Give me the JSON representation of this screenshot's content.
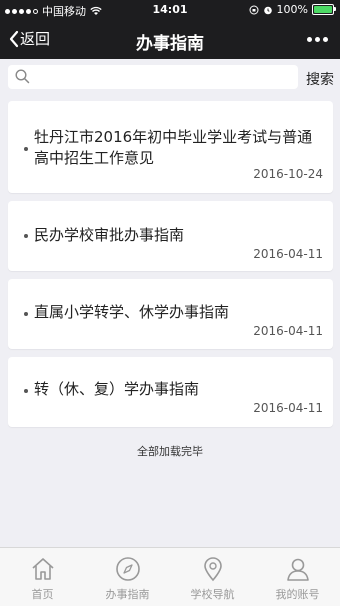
{
  "status_bar": {
    "carrier": "中国移动",
    "time": "14:01",
    "battery": "100%"
  },
  "nav": {
    "back_label": "返回",
    "title": "办事指南"
  },
  "search": {
    "placeholder": "",
    "button_label": "搜索"
  },
  "articles": [
    {
      "title": "牡丹江市2016年初中毕业学业考试与普通高中招生工作意见",
      "date": "2016-10-24"
    },
    {
      "title": "民办学校审批办事指南",
      "date": "2016-04-11"
    },
    {
      "title": "直属小学转学、休学办事指南",
      "date": "2016-04-11"
    },
    {
      "title": "转（休、复）学办事指南",
      "date": "2016-04-11"
    }
  ],
  "list_footer": "全部加载完毕",
  "tabs": [
    {
      "label": "首页",
      "icon": "home-icon"
    },
    {
      "label": "办事指南",
      "icon": "compass-icon"
    },
    {
      "label": "学校导航",
      "icon": "location-pin-icon"
    },
    {
      "label": "我的账号",
      "icon": "user-icon"
    }
  ]
}
